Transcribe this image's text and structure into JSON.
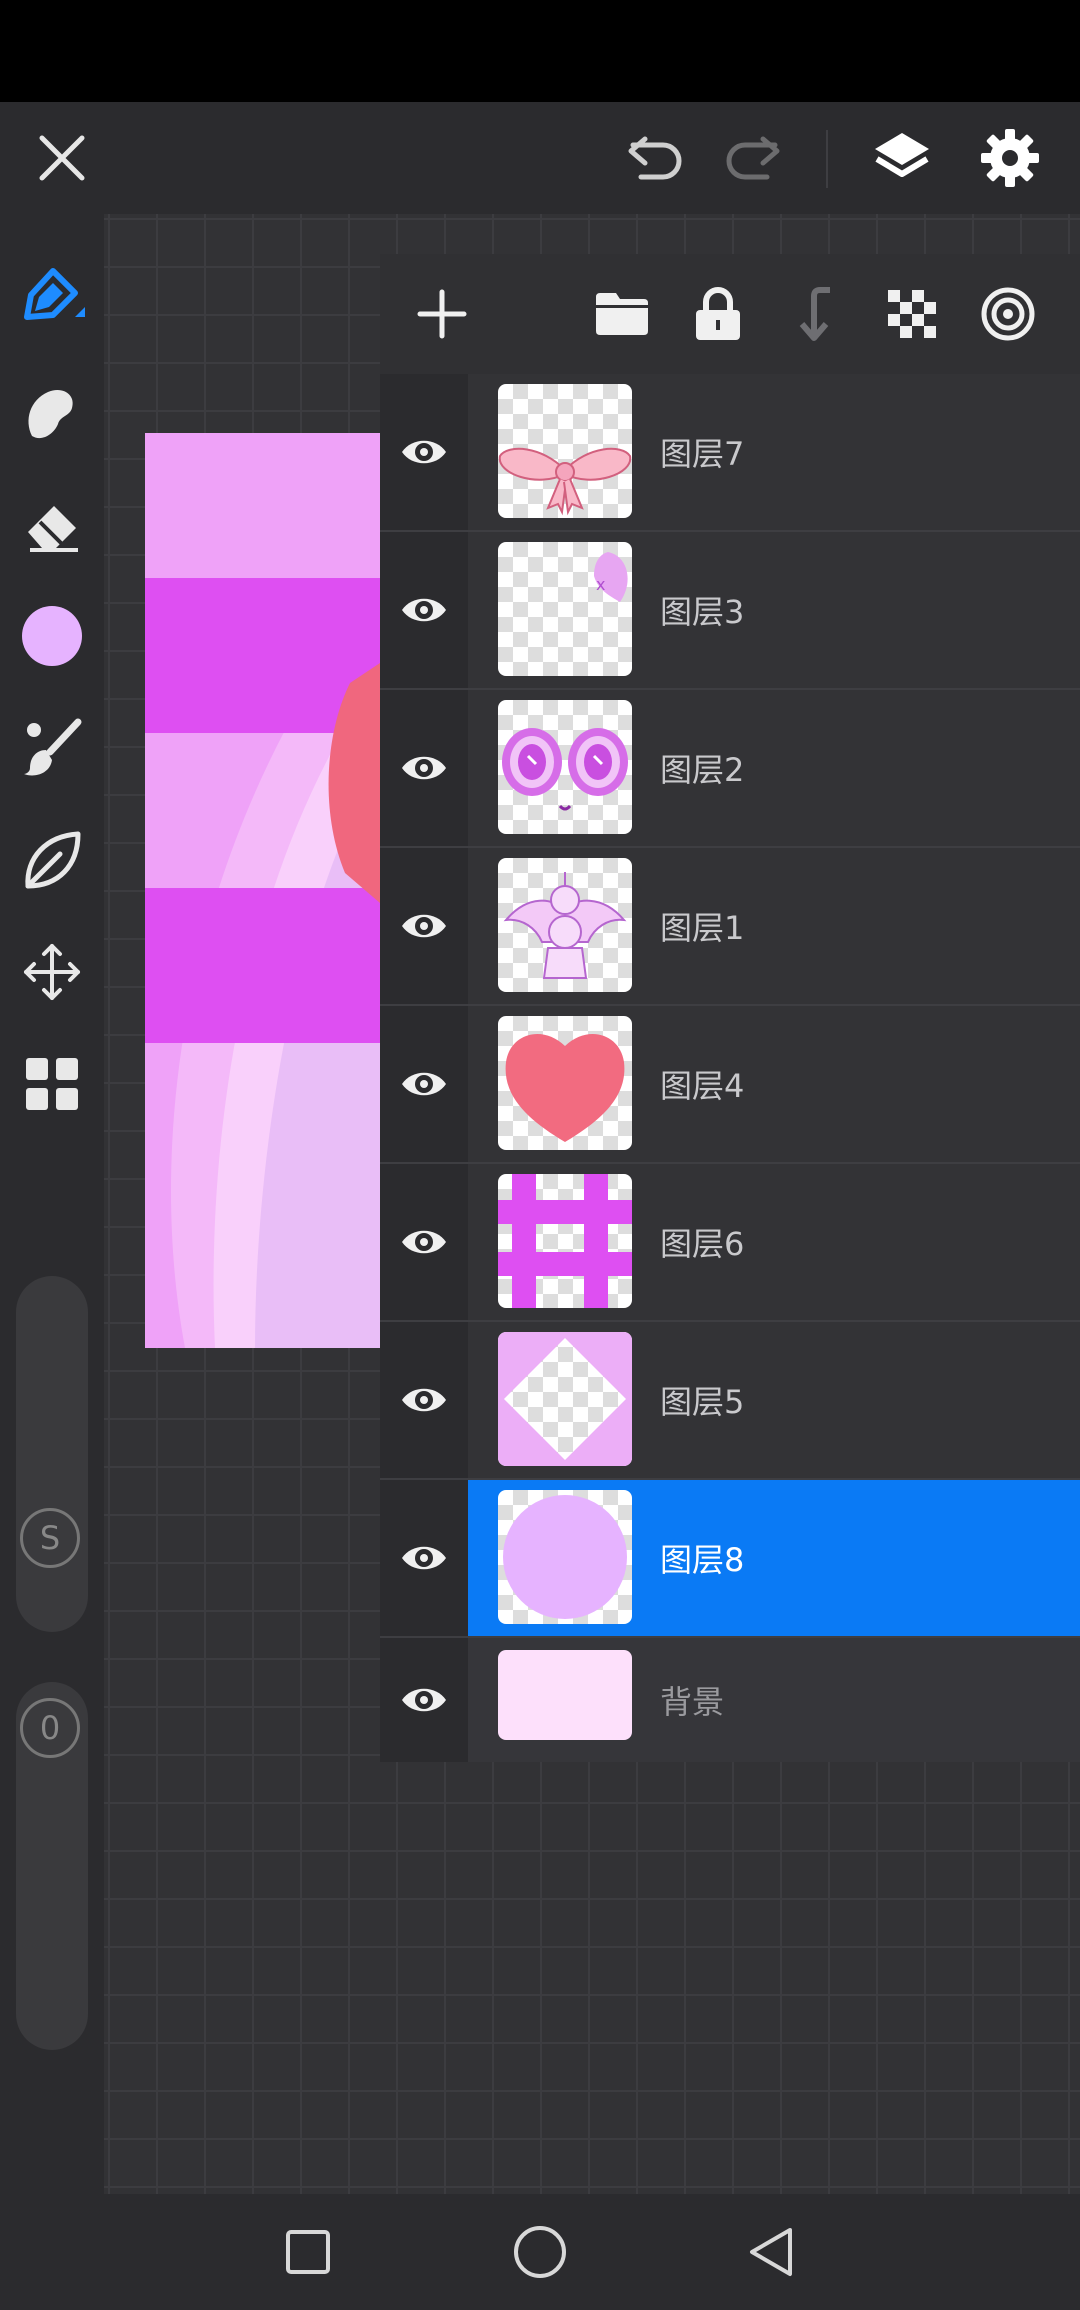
{
  "app": {
    "top_bar": {
      "close_icon": "close-icon",
      "undo_icon": "undo-icon",
      "redo_icon": "redo-icon",
      "layers_icon": "layers-icon",
      "settings_icon": "gear-icon"
    },
    "tools": [
      "pen-icon",
      "smudge-icon",
      "eraser-icon",
      "color-swatch",
      "brush-icon",
      "leaf-icon",
      "move-icon",
      "grid-icon"
    ],
    "current_color": "#e6b3ff",
    "size_slider_label": "S",
    "opacity_slider_label": "0"
  },
  "layers_panel": {
    "toolbar_icons": [
      "plus-icon",
      "folder-icon",
      "lock-icon",
      "merge-down-icon",
      "checkerboard-icon",
      "target-icon"
    ],
    "layers": [
      {
        "name": "图层7",
        "visible": true,
        "selected": false,
        "thumb": "bow"
      },
      {
        "name": "图层3",
        "visible": true,
        "selected": false,
        "thumb": "small"
      },
      {
        "name": "图层2",
        "visible": true,
        "selected": false,
        "thumb": "eyes"
      },
      {
        "name": "图层1",
        "visible": true,
        "selected": false,
        "thumb": "figure"
      },
      {
        "name": "图层4",
        "visible": true,
        "selected": false,
        "thumb": "heart"
      },
      {
        "name": "图层6",
        "visible": true,
        "selected": false,
        "thumb": "grid"
      },
      {
        "name": "图层5",
        "visible": true,
        "selected": false,
        "thumb": "diamond"
      },
      {
        "name": "图层8",
        "visible": true,
        "selected": true,
        "thumb": "circle"
      },
      {
        "name": "背景",
        "visible": true,
        "selected": false,
        "thumb": "background"
      }
    ]
  },
  "colors": {
    "accent": "#0a7af5",
    "pen_tool": "#1e8cff",
    "artwork_pink": "#efa2f8",
    "artwork_stripe": "#de4ff2"
  },
  "nav": {
    "icons": [
      "recent-apps-icon",
      "home-icon",
      "back-icon"
    ]
  }
}
